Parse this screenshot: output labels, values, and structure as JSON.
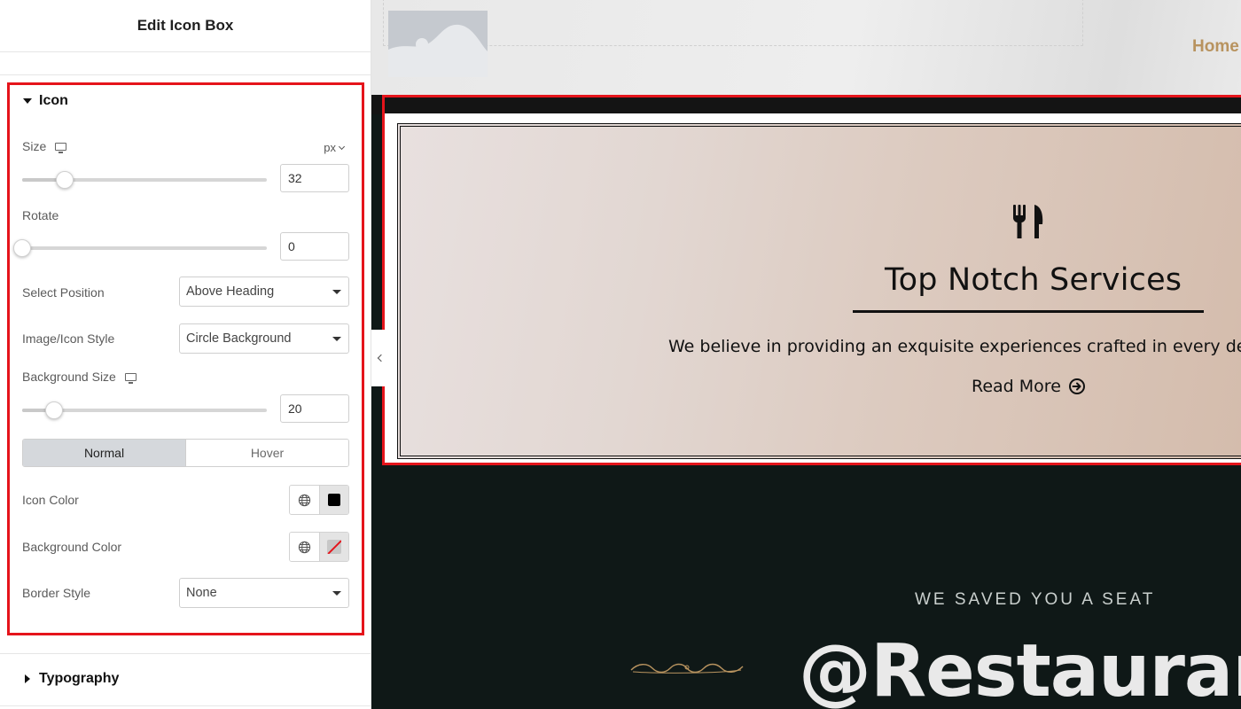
{
  "panel": {
    "title": "Edit Icon Box",
    "icon_section": {
      "title": "Icon",
      "size": {
        "label": "Size",
        "unit": "px",
        "value": "32",
        "slider_fraction": 0.15
      },
      "rotate": {
        "label": "Rotate",
        "value": "0",
        "slider_fraction": 0.0
      },
      "select_position": {
        "label": "Select Position",
        "value": "Above Heading"
      },
      "image_icon_style": {
        "label": "Image/Icon Style",
        "value": "Circle Background"
      },
      "background_size": {
        "label": "Background Size",
        "value": "20",
        "slider_fraction": 0.1
      },
      "state_tabs": {
        "normal": "Normal",
        "hover": "Hover",
        "active": "normal"
      },
      "icon_color": {
        "label": "Icon Color",
        "swatch": "#000000"
      },
      "background_color": {
        "label": "Background Color",
        "swatch": "none"
      },
      "border_style": {
        "label": "Border Style",
        "value": "None"
      }
    },
    "typography_section": {
      "title": "Typography"
    }
  },
  "preview": {
    "nav": {
      "home": "Home"
    },
    "card": {
      "icon": "utensils-icon",
      "title": "Top Notch Services",
      "description": "We believe in providing an exquisite experiences crafted in every delicacy",
      "read_more": "Read More",
      "read_more_icon": "arrow-circle-right-icon"
    },
    "seat_text": "WE SAVED YOU A SEAT",
    "big_text": "@Restaurant"
  },
  "colors": {
    "selection": "#e5141b",
    "nav_accent": "#b8935f",
    "dark_section": "#0f1817",
    "flourish": "#b8935f"
  }
}
